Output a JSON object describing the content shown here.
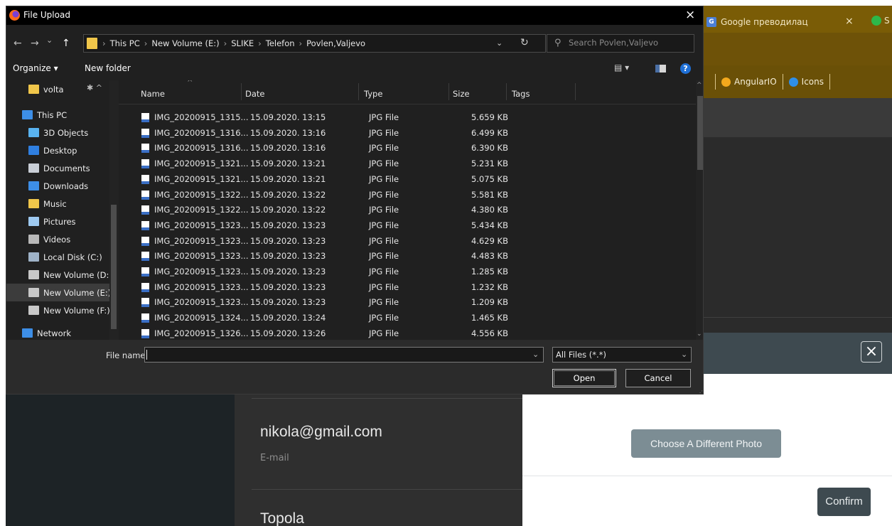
{
  "background_app": {
    "tab_title": "Google преводилац",
    "tab_close": "×",
    "tab2_label": "S",
    "bookmarks": [
      {
        "label": "AngularIO",
        "color": "#f2a81d"
      },
      {
        "label": "Icons",
        "color": "#2f8fe8"
      }
    ],
    "email_value": "nikola@gmail.com",
    "email_label": "E-mail",
    "city_value": "Topola"
  },
  "photo_modal": {
    "close_label": "×",
    "choose_button": "Choose A Different Photo",
    "confirm_button": "Confirm"
  },
  "file_dialog": {
    "title": "File Upload",
    "close": "×",
    "nav": {
      "back": "←",
      "forward": "→",
      "recent": "⌄",
      "up": "↑"
    },
    "breadcrumb": [
      "This PC",
      "New Volume (E:)",
      "SLIKE",
      "Telefon",
      "Povlen,Valjevo"
    ],
    "breadcrumb_sep": "›",
    "search_placeholder": "Search Povlen,Valjevo",
    "organize_label": "Organize ▾",
    "new_folder_label": "New folder",
    "view_label": "▤ ▾",
    "help_label": "?",
    "nav_pane": [
      {
        "label": "volta",
        "icon": "folder-icon",
        "color": "#f0c64a",
        "root": false
      },
      {
        "label": "This PC",
        "icon": "computer-icon",
        "color": "#3d8ee6",
        "root": true
      },
      {
        "label": "3D Objects",
        "icon": "cube-icon",
        "color": "#59b3f0",
        "root": false
      },
      {
        "label": "Desktop",
        "icon": "desktop-icon",
        "color": "#2f7fe0",
        "root": false
      },
      {
        "label": "Documents",
        "icon": "document-icon",
        "color": "#c9ced6",
        "root": false
      },
      {
        "label": "Downloads",
        "icon": "download-icon",
        "color": "#3d8ee6",
        "root": false
      },
      {
        "label": "Music",
        "icon": "music-icon",
        "color": "#f0c64a",
        "root": false
      },
      {
        "label": "Pictures",
        "icon": "pictures-icon",
        "color": "#9ec9f0",
        "root": false
      },
      {
        "label": "Videos",
        "icon": "videos-icon",
        "color": "#b8b8b8",
        "root": false
      },
      {
        "label": "Local Disk (C:)",
        "icon": "disk-icon",
        "color": "#9fb3c8",
        "root": false
      },
      {
        "label": "New Volume (D:)",
        "icon": "drive-icon",
        "color": "#c8c8c8",
        "root": false
      },
      {
        "label": "New Volume (E:)",
        "icon": "drive-icon",
        "color": "#c8c8c8",
        "root": false,
        "selected": true
      },
      {
        "label": "New Volume (F:)",
        "icon": "drive-icon",
        "color": "#c8c8c8",
        "root": false
      },
      {
        "label": "Network",
        "icon": "network-icon",
        "color": "#3d8ee6",
        "root": true
      }
    ],
    "pin": "✱ ^",
    "columns": [
      "Name",
      "Date",
      "Type",
      "Size",
      "Tags"
    ],
    "files": [
      {
        "name": "IMG_20200915_1315...",
        "date": "15.09.2020. 13:15",
        "type": "JPG File",
        "size": "5.659 KB"
      },
      {
        "name": "IMG_20200915_1316...",
        "date": "15.09.2020. 13:16",
        "type": "JPG File",
        "size": "6.499 KB"
      },
      {
        "name": "IMG_20200915_1316...",
        "date": "15.09.2020. 13:16",
        "type": "JPG File",
        "size": "6.390 KB"
      },
      {
        "name": "IMG_20200915_1321...",
        "date": "15.09.2020. 13:21",
        "type": "JPG File",
        "size": "5.231 KB"
      },
      {
        "name": "IMG_20200915_1321...",
        "date": "15.09.2020. 13:21",
        "type": "JPG File",
        "size": "5.075 KB"
      },
      {
        "name": "IMG_20200915_1322...",
        "date": "15.09.2020. 13:22",
        "type": "JPG File",
        "size": "5.581 KB"
      },
      {
        "name": "IMG_20200915_1322...",
        "date": "15.09.2020. 13:22",
        "type": "JPG File",
        "size": "4.380 KB"
      },
      {
        "name": "IMG_20200915_1323...",
        "date": "15.09.2020. 13:23",
        "type": "JPG File",
        "size": "5.434 KB"
      },
      {
        "name": "IMG_20200915_1323...",
        "date": "15.09.2020. 13:23",
        "type": "JPG File",
        "size": "4.629 KB"
      },
      {
        "name": "IMG_20200915_1323...",
        "date": "15.09.2020. 13:23",
        "type": "JPG File",
        "size": "4.483 KB"
      },
      {
        "name": "IMG_20200915_1323...",
        "date": "15.09.2020. 13:23",
        "type": "JPG File",
        "size": "1.285 KB"
      },
      {
        "name": "IMG_20200915_1323...",
        "date": "15.09.2020. 13:23",
        "type": "JPG File",
        "size": "1.232 KB"
      },
      {
        "name": "IMG_20200915_1323...",
        "date": "15.09.2020. 13:23",
        "type": "JPG File",
        "size": "1.209 KB"
      },
      {
        "name": "IMG_20200915_1324...",
        "date": "15.09.2020. 13:24",
        "type": "JPG File",
        "size": "1.465 KB"
      },
      {
        "name": "IMG_20200915_1326...",
        "date": "15.09.2020. 13:26",
        "type": "JPG File",
        "size": "4.556 KB"
      }
    ],
    "filename_label": "File name:",
    "filename_value": "",
    "filetype_value": "All Files (*.*)",
    "open_button": "Open",
    "cancel_button": "Cancel"
  }
}
